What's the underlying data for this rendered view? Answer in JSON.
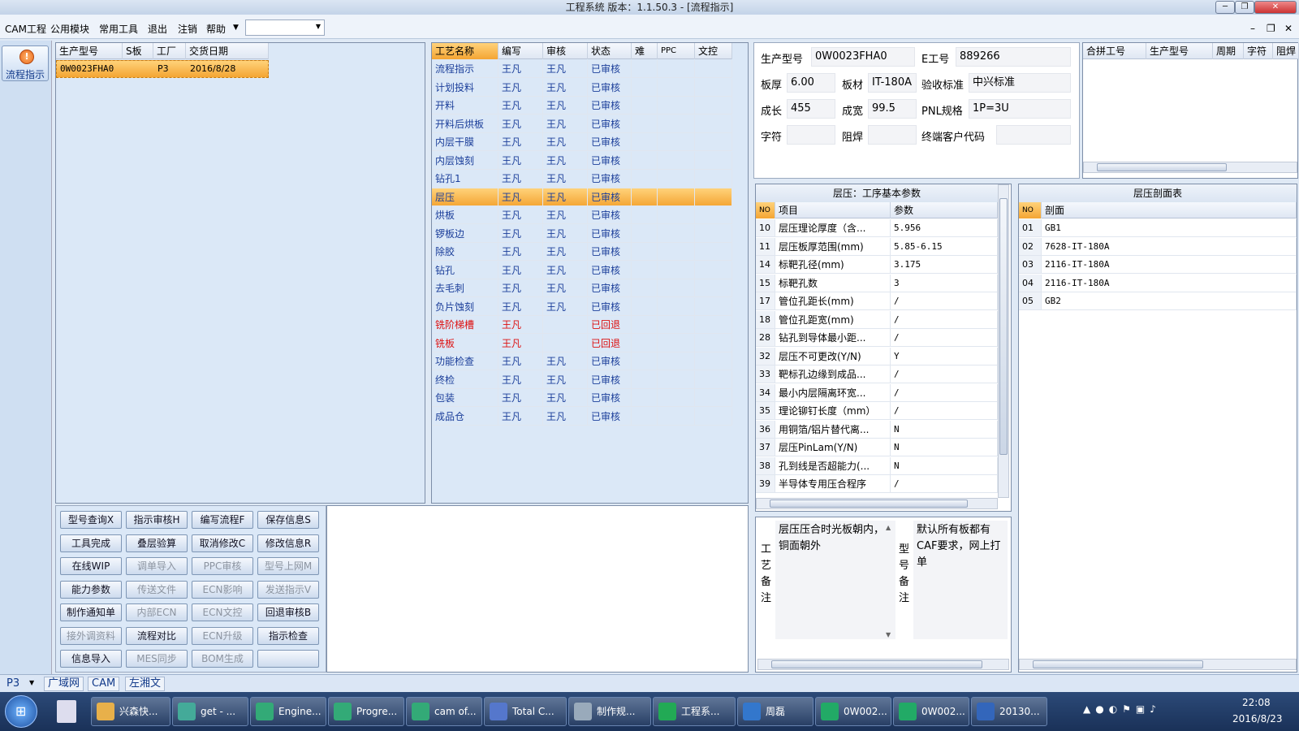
{
  "window": {
    "title": "工程系统   版本：1.1.50.3 - [流程指示]"
  },
  "menu": {
    "items": [
      "CAM工程",
      "公用模块",
      "常用工具",
      "退出",
      "注销",
      "帮助"
    ]
  },
  "sidebar": {
    "flow_label": "流程指示"
  },
  "orders": {
    "headers": [
      "生产型号",
      "S板",
      "工厂",
      "交货日期"
    ],
    "rows": [
      {
        "model": "0W0023FHA0",
        "s": "",
        "factory": "P3",
        "date": "2016/8/28"
      }
    ]
  },
  "process": {
    "headers": [
      "工艺名称",
      "编写",
      "审核",
      "状态",
      "难",
      "PPC",
      "文控"
    ],
    "rows": [
      {
        "name": "流程指示",
        "writer": "王凡",
        "reviewer": "王凡",
        "status": "已审核",
        "red": false
      },
      {
        "name": "计划投料",
        "writer": "王凡",
        "reviewer": "王凡",
        "status": "已审核",
        "red": false
      },
      {
        "name": "开料",
        "writer": "王凡",
        "reviewer": "王凡",
        "status": "已审核",
        "red": false
      },
      {
        "name": "开料后烘板",
        "writer": "王凡",
        "reviewer": "王凡",
        "status": "已审核",
        "red": false
      },
      {
        "name": "内层干膜",
        "writer": "王凡",
        "reviewer": "王凡",
        "status": "已审核",
        "red": false
      },
      {
        "name": "内层蚀刻",
        "writer": "王凡",
        "reviewer": "王凡",
        "status": "已审核",
        "red": false
      },
      {
        "name": "钻孔1",
        "writer": "王凡",
        "reviewer": "王凡",
        "status": "已审核",
        "red": false
      },
      {
        "name": "层压",
        "writer": "王凡",
        "reviewer": "王凡",
        "status": "已审核",
        "red": false,
        "selected": true
      },
      {
        "name": "烘板",
        "writer": "王凡",
        "reviewer": "王凡",
        "status": "已审核",
        "red": false
      },
      {
        "name": "锣板边",
        "writer": "王凡",
        "reviewer": "王凡",
        "status": "已审核",
        "red": false
      },
      {
        "name": "除胶",
        "writer": "王凡",
        "reviewer": "王凡",
        "status": "已审核",
        "red": false
      },
      {
        "name": "钻孔",
        "writer": "王凡",
        "reviewer": "王凡",
        "status": "已审核",
        "red": false
      },
      {
        "name": "去毛刺",
        "writer": "王凡",
        "reviewer": "王凡",
        "status": "已审核",
        "red": false
      },
      {
        "name": "负片蚀刻",
        "writer": "王凡",
        "reviewer": "王凡",
        "status": "已审核",
        "red": false
      },
      {
        "name": "铣阶梯槽",
        "writer": "王凡",
        "reviewer": "",
        "status": "已回退",
        "red": true
      },
      {
        "name": "铣板",
        "writer": "王凡",
        "reviewer": "",
        "status": "已回退",
        "red": true
      },
      {
        "name": "功能检查",
        "writer": "王凡",
        "reviewer": "王凡",
        "status": "已审核",
        "red": false
      },
      {
        "name": "终检",
        "writer": "王凡",
        "reviewer": "王凡",
        "status": "已审核",
        "red": false
      },
      {
        "name": "包装",
        "writer": "王凡",
        "reviewer": "王凡",
        "status": "已审核",
        "red": false
      },
      {
        "name": "成品仓",
        "writer": "王凡",
        "reviewer": "王凡",
        "status": "已审核",
        "red": false
      }
    ]
  },
  "info": {
    "model_label": "生产型号",
    "model": "0W0023FHA0",
    "e_label": "E工号",
    "e": "889266",
    "thick_label": "板厚",
    "thick": "6.00",
    "mat_label": "板材",
    "mat": "IT-180A",
    "std_label": "验收标准",
    "std": "中兴标准",
    "len_label": "成长",
    "len": "455",
    "wid_label": "成宽",
    "wid": "99.5",
    "pnl_label": "PNL规格",
    "pnl": "1P=3U",
    "char_label": "字符",
    "char": "",
    "mask_label": "阻焊",
    "mask": "",
    "cust_label": "终端客户代码",
    "cust": ""
  },
  "combo": {
    "headers": [
      "合拼工号",
      "生产型号",
      "周期",
      "字符",
      "阻焊"
    ]
  },
  "params": {
    "title": "层压：工序基本参数",
    "headers": [
      "NO",
      "项目",
      "参数"
    ],
    "rows": [
      {
        "no": "10",
        "item": "层压理论厚度（含...",
        "val": "5.956"
      },
      {
        "no": "11",
        "item": "层压板厚范围(mm)",
        "val": "5.85-6.15"
      },
      {
        "no": "14",
        "item": "标靶孔径(mm)",
        "val": "3.175"
      },
      {
        "no": "15",
        "item": "标靶孔数",
        "val": "3"
      },
      {
        "no": "17",
        "item": "管位孔距长(mm)",
        "val": "/"
      },
      {
        "no": "18",
        "item": "管位孔距宽(mm)",
        "val": "/"
      },
      {
        "no": "28",
        "item": "钻孔到导体最小距...",
        "val": "/"
      },
      {
        "no": "32",
        "item": "层压不可更改(Y/N)",
        "val": "Y"
      },
      {
        "no": "33",
        "item": "靶标孔边缘到成品...",
        "val": "/"
      },
      {
        "no": "34",
        "item": "最小内层隔离环宽...",
        "val": "/"
      },
      {
        "no": "35",
        "item": "理论铆钉长度（mm）",
        "val": "/"
      },
      {
        "no": "36",
        "item": "用铜箔/铝片替代离...",
        "val": "N"
      },
      {
        "no": "37",
        "item": "层压PinLam(Y/N)",
        "val": "N"
      },
      {
        "no": "38",
        "item": "孔到线是否超能力(...",
        "val": "N"
      },
      {
        "no": "39",
        "item": "半导体专用压合程序",
        "val": "/"
      }
    ]
  },
  "stack": {
    "title": "层压剖面表",
    "headers": [
      "NO",
      "剖面"
    ],
    "rows": [
      {
        "no": "01",
        "val": "GB1"
      },
      {
        "no": "02",
        "val": "7628-IT-180A"
      },
      {
        "no": "03",
        "val": "2116-IT-180A"
      },
      {
        "no": "04",
        "val": "2116-IT-180A"
      },
      {
        "no": "05",
        "val": "GB2"
      }
    ]
  },
  "notes": {
    "craft_label": "工艺备注",
    "craft": "层压压合时光板朝内，铜面朝外",
    "model_label": "型号备注",
    "model": "默认所有板都有CAF要求，网上打单"
  },
  "buttons": [
    [
      "型号查询X",
      "指示审核H",
      "编写流程F",
      "保存信息S"
    ],
    [
      "工具完成",
      "叠层验算",
      "取消修改C",
      "修改信息R"
    ],
    [
      "在线WIP",
      "调单导入",
      "PPC审核",
      "型号上网M"
    ],
    [
      "能力参数",
      "传送文件",
      "ECN影响",
      "发送指示V"
    ],
    [
      "制作通知单",
      "内部ECN",
      "ECN文控",
      "回退审核B"
    ],
    [
      "接外调资料",
      "流程对比",
      "ECN升级",
      "指示检查"
    ],
    [
      "信息导入",
      "MES同步",
      "BOM生成",
      ""
    ]
  ],
  "status": {
    "factory": "P3",
    "tabs": [
      "广域网",
      "CAM",
      "左湘文"
    ]
  },
  "taskbar": {
    "items": [
      "兴森快...",
      "get - ...",
      "Engine...",
      "Progre...",
      "cam of...",
      "Total C...",
      "制作规...",
      "工程系...",
      "周磊",
      "0W002...",
      "0W002...",
      "20130..."
    ],
    "time": "22:08",
    "date": "2016/8/23"
  }
}
